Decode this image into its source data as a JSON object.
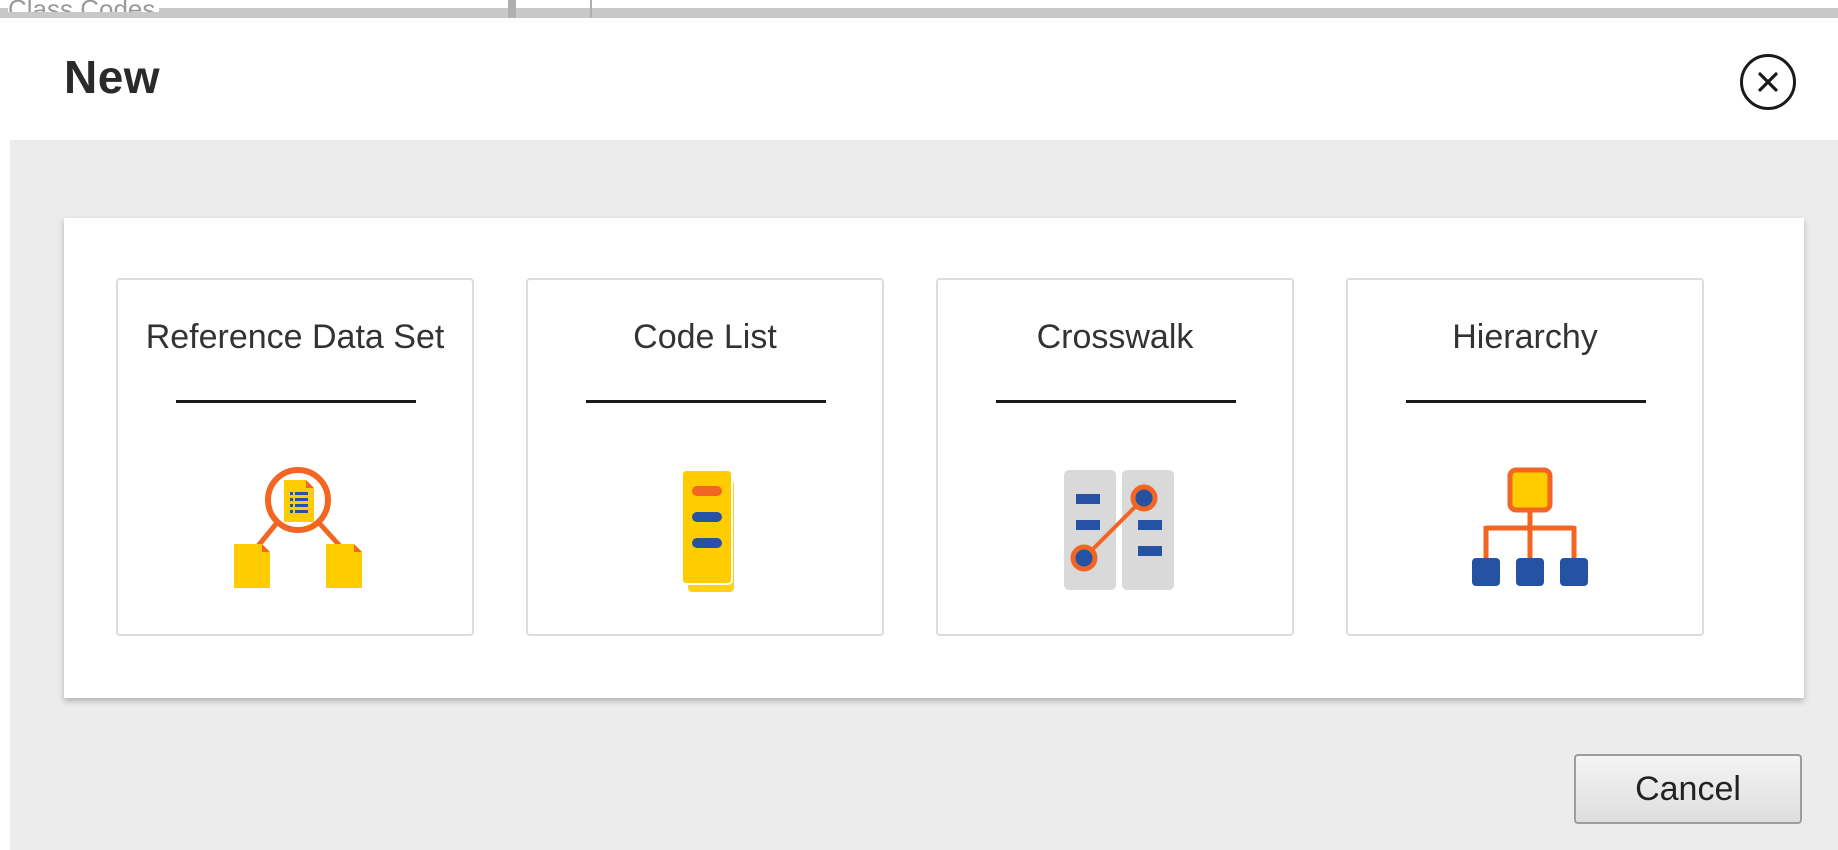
{
  "background_page": {
    "partial_text": "Class Codes"
  },
  "dialog": {
    "title": "New",
    "close_icon": "close-icon",
    "tiles": [
      {
        "label": "Reference Data Set",
        "icon": "reference-data-set-icon"
      },
      {
        "label": "Code List",
        "icon": "code-list-icon"
      },
      {
        "label": "Crosswalk",
        "icon": "crosswalk-icon"
      },
      {
        "label": "Hierarchy",
        "icon": "hierarchy-icon"
      }
    ],
    "cancel_label": "Cancel"
  },
  "colors": {
    "accent_orange": "#f26522",
    "accent_yellow": "#ffcc00",
    "accent_blue": "#2552a3",
    "icon_gray": "#d9d9d9",
    "dialog_body_bg": "#ececec"
  }
}
